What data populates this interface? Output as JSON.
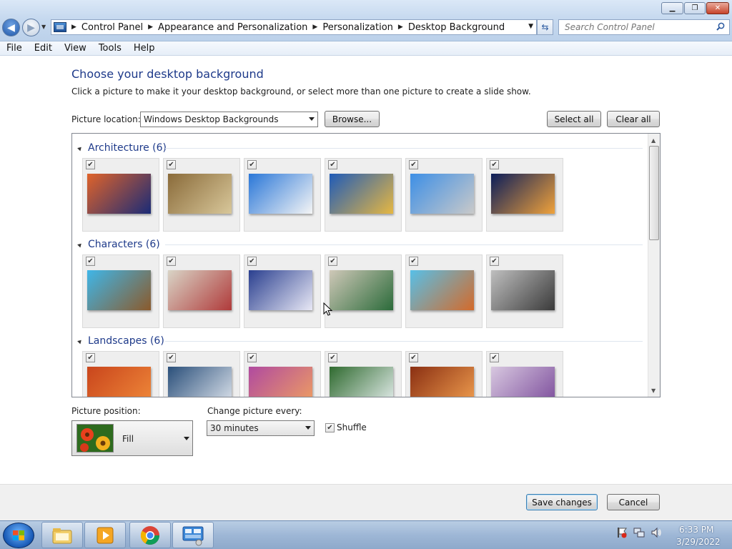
{
  "window": {
    "min_label": "▁",
    "max_label": "❐",
    "close_label": "✕"
  },
  "address": {
    "breadcrumbs": [
      "Control Panel",
      "Appearance and Personalization",
      "Personalization",
      "Desktop Background"
    ]
  },
  "search": {
    "placeholder": "Search Control Panel"
  },
  "menu": [
    "File",
    "Edit",
    "View",
    "Tools",
    "Help"
  ],
  "page": {
    "title": "Choose your desktop background",
    "description": "Click a picture to make it your desktop background, or select more than one picture to create a slide show."
  },
  "location": {
    "label": "Picture location:",
    "value": "Windows Desktop Backgrounds",
    "browse_label": "Browse...",
    "select_all_label": "Select all",
    "clear_all_label": "Clear all"
  },
  "gallery": {
    "groups": [
      {
        "title": "Architecture (6)",
        "tiles": [
          true,
          true,
          true,
          true,
          true,
          true
        ],
        "colors": [
          [
            "#e0632a",
            "#1a2b77"
          ],
          [
            "#8a6b3a",
            "#d8c79a"
          ],
          [
            "#2a77d8",
            "#f5f5f5"
          ],
          [
            "#1f5bb8",
            "#e6b742"
          ],
          [
            "#3d8fe6",
            "#c9c9c9"
          ],
          [
            "#0b1d5a",
            "#f0a23b"
          ]
        ]
      },
      {
        "title": "Characters (6)",
        "tiles": [
          true,
          true,
          true,
          true,
          true,
          true
        ],
        "colors": [
          [
            "#3fb6e8",
            "#8b5a2b"
          ],
          [
            "#d9d4c6",
            "#b03a3a"
          ],
          [
            "#2a3f8f",
            "#e8e8f5"
          ],
          [
            "#cfc8b8",
            "#2b6b3a"
          ],
          [
            "#57c0e8",
            "#d46a2a"
          ],
          [
            "#bfbfbf",
            "#3a3a3a"
          ]
        ]
      },
      {
        "title": "Landscapes (6)",
        "tiles": [
          true,
          true,
          true,
          true,
          true,
          true
        ],
        "colors": [
          [
            "#c9451c",
            "#f08a3a"
          ],
          [
            "#2a4f7a",
            "#e0e6ee"
          ],
          [
            "#b04aa0",
            "#f0a060"
          ],
          [
            "#2f6a2f",
            "#e8f0f0"
          ],
          [
            "#8a2f12",
            "#f2a050"
          ],
          [
            "#d8c8e0",
            "#7a4a9a"
          ]
        ]
      }
    ]
  },
  "position": {
    "label": "Picture position:",
    "value": "Fill"
  },
  "interval": {
    "label": "Change picture every:",
    "value": "30 minutes"
  },
  "shuffle": {
    "label": "Shuffle",
    "checked": true
  },
  "footer": {
    "save_label": "Save changes",
    "cancel_label": "Cancel"
  },
  "clock": {
    "time": "6:33 PM",
    "date": "3/29/2022"
  }
}
